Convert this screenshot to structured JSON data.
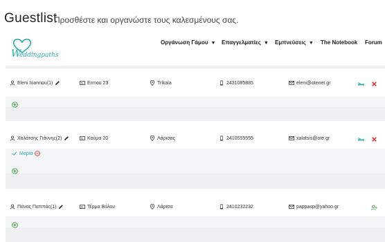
{
  "header": {
    "title": "Guestlist",
    "subtitle": "Προσθέστε και οργανώστε τους καλεσμένους σας."
  },
  "brand": {
    "logo_text": "eddingpaths",
    "accent": "#29a9b0"
  },
  "nav": {
    "items": [
      {
        "label": "Οργάνωση Γάμου",
        "has_dropdown": true
      },
      {
        "label": "Επαγγελματίες",
        "has_dropdown": true
      },
      {
        "label": "Εμπνεύσεις",
        "has_dropdown": true
      },
      {
        "label": "The Notebook",
        "has_dropdown": false
      },
      {
        "label": "Forum",
        "has_dropdown": false
      }
    ]
  },
  "guests": [
    {
      "name": "Eleni Ioannou(1)",
      "address": "Ermou 23",
      "city": "Trikala",
      "phone": "2431085885",
      "email": "eleni@otenet.gr",
      "companions": []
    },
    {
      "name": "Χαλάτσης Γιάννης(2)",
      "address": "Κούμα 20",
      "city": "Λάρισας",
      "phone": "2410555555",
      "email": "xalatsis@ote.gr",
      "companions": [
        {
          "name": "Μαρία"
        }
      ]
    },
    {
      "name": "Πάνος Παππάς(1)",
      "address": "Τέρμα Βόλου",
      "city": "Λάρισα",
      "phone": "2410232232",
      "email": "pappasp@yahoo.gr",
      "companions": []
    }
  ],
  "colors": {
    "delete": "#e0302e",
    "add": "#2e9f2e",
    "companion": "#29a9b0",
    "bed": "#29a9b0",
    "remove": "#e0302e"
  }
}
